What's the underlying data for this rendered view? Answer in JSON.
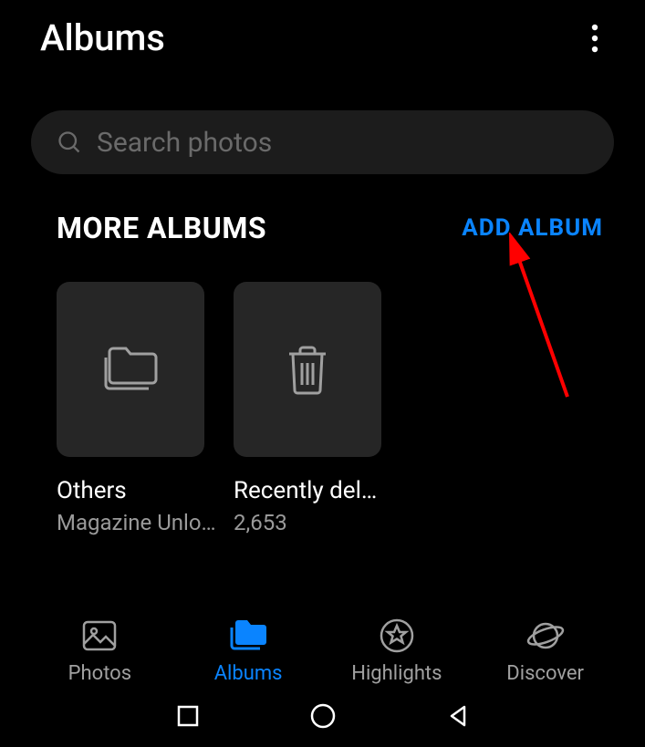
{
  "header": {
    "title": "Albums"
  },
  "search": {
    "placeholder": "Search photos"
  },
  "section": {
    "title": "MORE ALBUMS",
    "add_label": "ADD ALBUM"
  },
  "albums": [
    {
      "title": "Others",
      "subtitle": "Magazine Unlo…",
      "icon": "folder"
    },
    {
      "title": "Recently del…",
      "subtitle": "2,653",
      "icon": "trash"
    }
  ],
  "tabs": [
    {
      "label": "Photos",
      "icon": "image",
      "active": false
    },
    {
      "label": "Albums",
      "icon": "folders",
      "active": true
    },
    {
      "label": "Highlights",
      "icon": "star",
      "active": false
    },
    {
      "label": "Discover",
      "icon": "planet",
      "active": false
    }
  ]
}
